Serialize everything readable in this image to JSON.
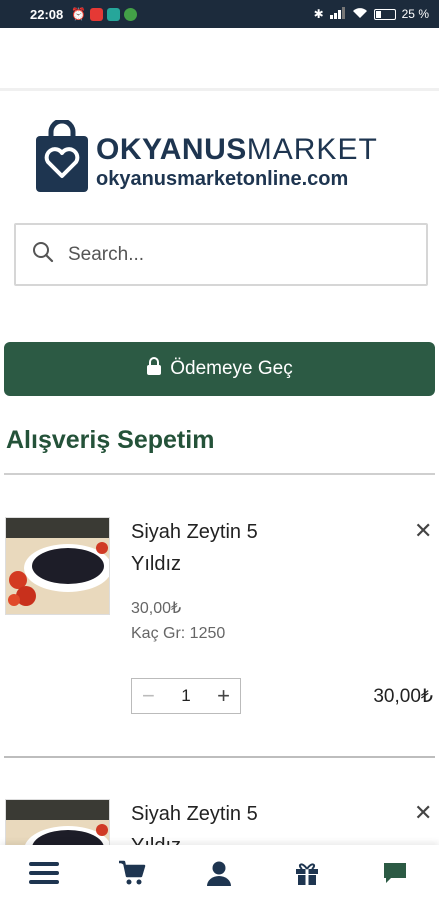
{
  "status_bar": {
    "time": "22:08",
    "battery": "25"
  },
  "logo": {
    "brand_bold": "OKYANUS",
    "brand_light": "MARKET",
    "domain": "okyanusmarketonline.com"
  },
  "search": {
    "placeholder": "Search..."
  },
  "checkout": {
    "label": "Ödemeye Geç"
  },
  "cart": {
    "title": "Alışveriş Sepetim",
    "items": [
      {
        "name_line1": "Siyah Zeytin 5",
        "name_line2": "Yıldız",
        "price": "30,00₺",
        "meta": "Kaç Gr: 1250",
        "quantity": "1",
        "total": "30,00₺"
      },
      {
        "name_line1": "Siyah Zeytin 5",
        "name_line2": "Yıldız"
      }
    ]
  },
  "colors": {
    "brand_navy": "#1e3550",
    "brand_green": "#2c5a44",
    "status_bar": "#1c2b3c"
  },
  "bottom_nav": [
    "menu-icon",
    "cart-icon",
    "account-icon",
    "gift-icon",
    "chat-icon"
  ]
}
